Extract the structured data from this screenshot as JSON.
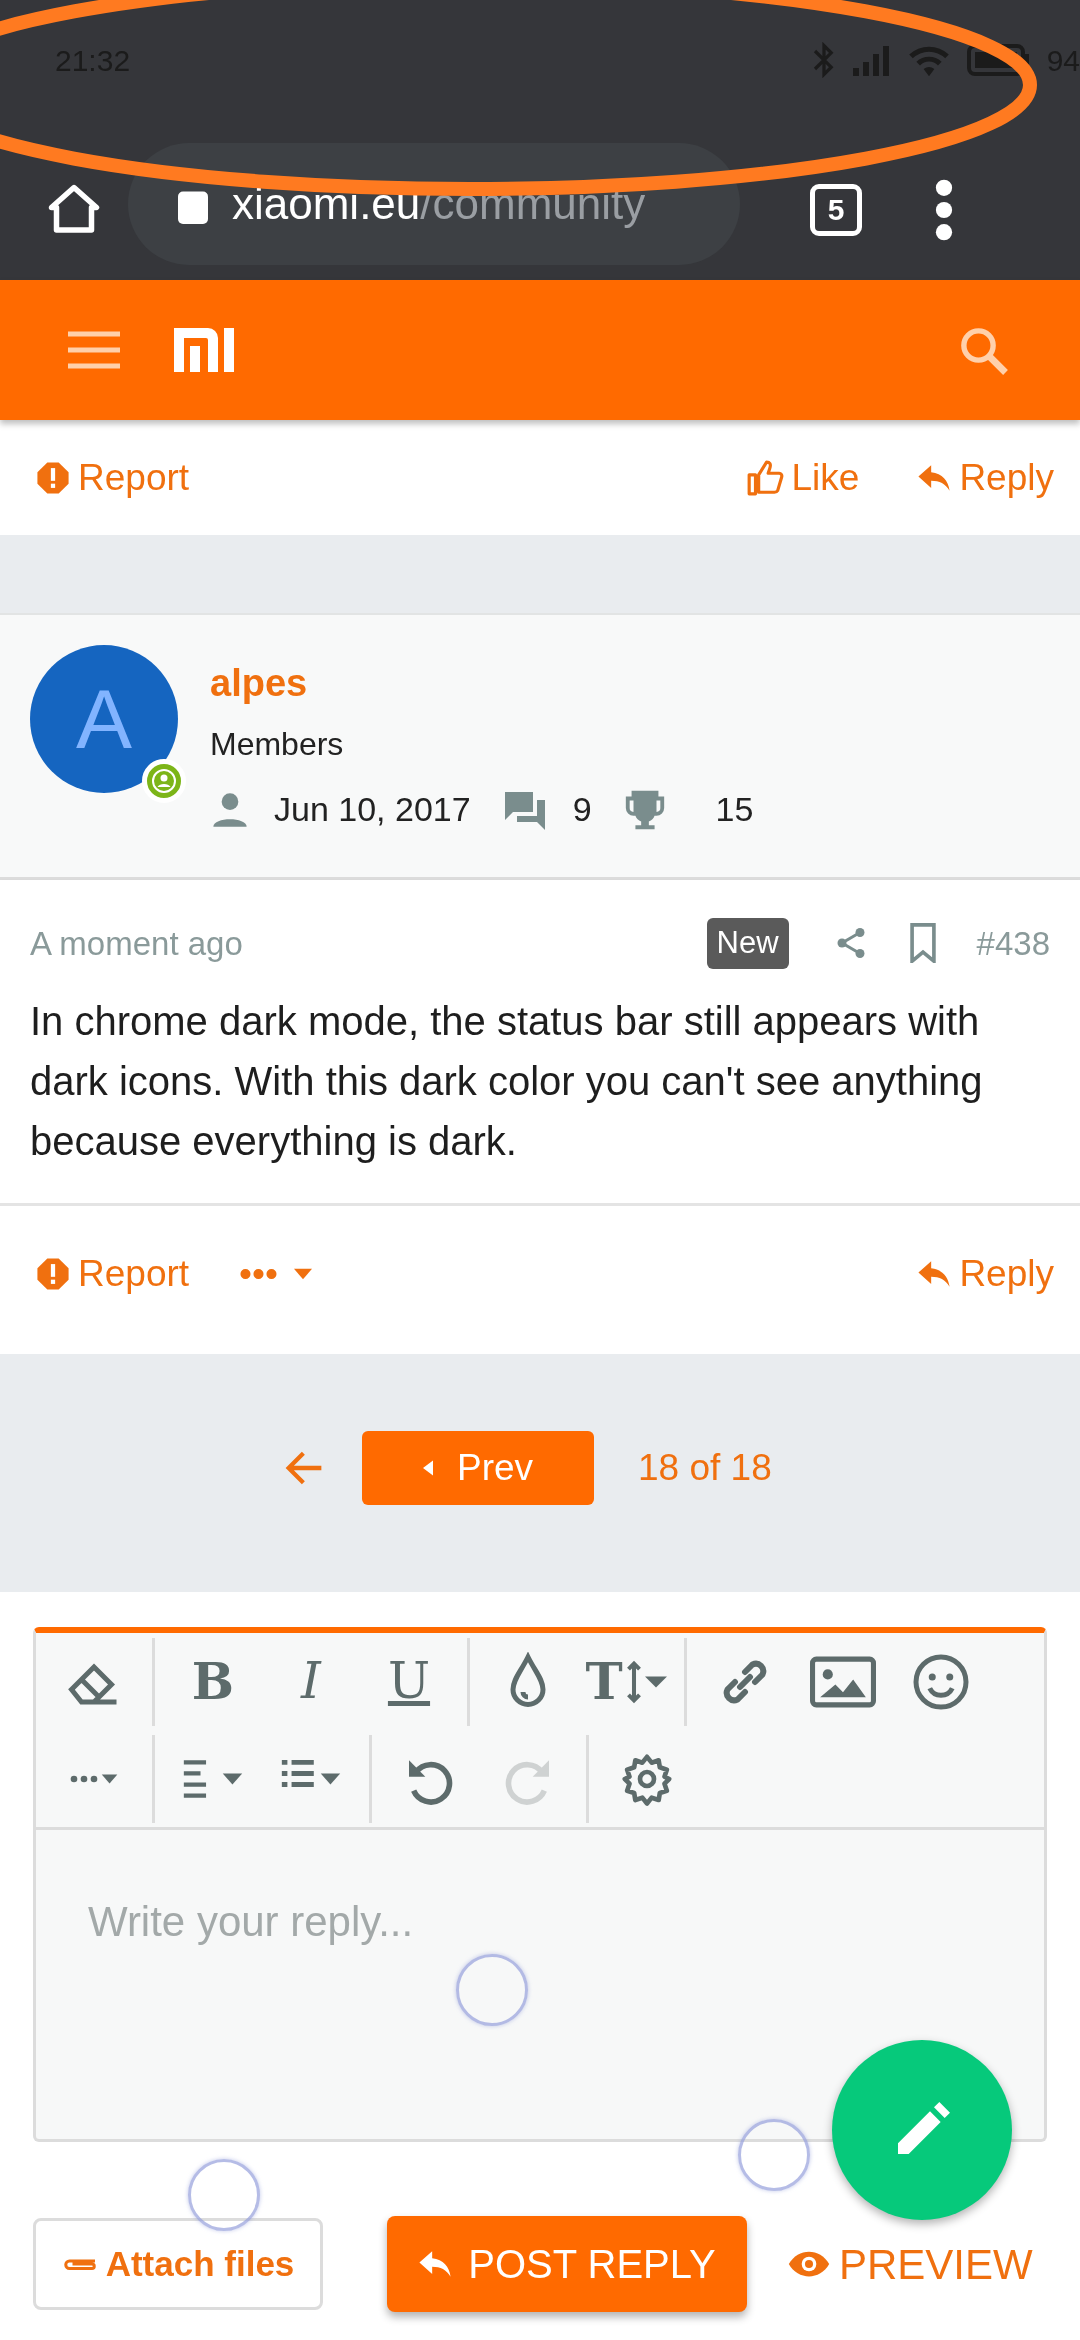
{
  "status_bar": {
    "time": "21:32",
    "battery": "94"
  },
  "browser": {
    "url_host": "xiaomi.eu",
    "url_path": "/community",
    "tab_count": "5"
  },
  "previous_post_actions": {
    "report": "Report",
    "like": "Like",
    "reply": "Reply"
  },
  "post": {
    "author": {
      "initial": "A",
      "name": "alpes",
      "group": "Members",
      "joined": "Jun 10, 2017",
      "messages": "9",
      "points": "15",
      "online": true
    },
    "time": "A moment ago",
    "badge": "New",
    "number": "#438",
    "body": "In chrome dark mode, the status bar still appears with dark icons. With this dark color you can't see anything because everything is dark.",
    "actions": {
      "report": "Report",
      "more": "•••",
      "reply": "Reply"
    }
  },
  "pagination": {
    "prev": "Prev",
    "status": "18 of 18"
  },
  "editor": {
    "toolbar": [
      [
        [
          {
            "kind": "eraser",
            "disabled": false
          }
        ],
        [
          {
            "kind": "bold",
            "label": "B",
            "disabled": false
          },
          {
            "kind": "italic",
            "label": "I",
            "disabled": false
          },
          {
            "kind": "underline",
            "label": "U",
            "disabled": false
          }
        ],
        [
          {
            "kind": "color",
            "disabled": false
          },
          {
            "kind": "size",
            "label": "T",
            "disabled": false
          }
        ],
        [
          {
            "kind": "link",
            "disabled": false
          },
          {
            "kind": "image",
            "disabled": false
          },
          {
            "kind": "smiley",
            "disabled": false
          }
        ]
      ],
      [
        [
          {
            "kind": "more",
            "disabled": false
          }
        ],
        [
          {
            "kind": "align",
            "disabled": false
          },
          {
            "kind": "list",
            "disabled": false
          }
        ],
        [
          {
            "kind": "undo",
            "disabled": false
          },
          {
            "kind": "redo",
            "disabled": true
          }
        ],
        [
          {
            "kind": "settings",
            "disabled": false
          }
        ]
      ]
    ],
    "placeholder": "Write your reply..."
  },
  "buttons": {
    "attach": "Attach files",
    "post": "POST REPLY",
    "preview": "PREVIEW"
  }
}
